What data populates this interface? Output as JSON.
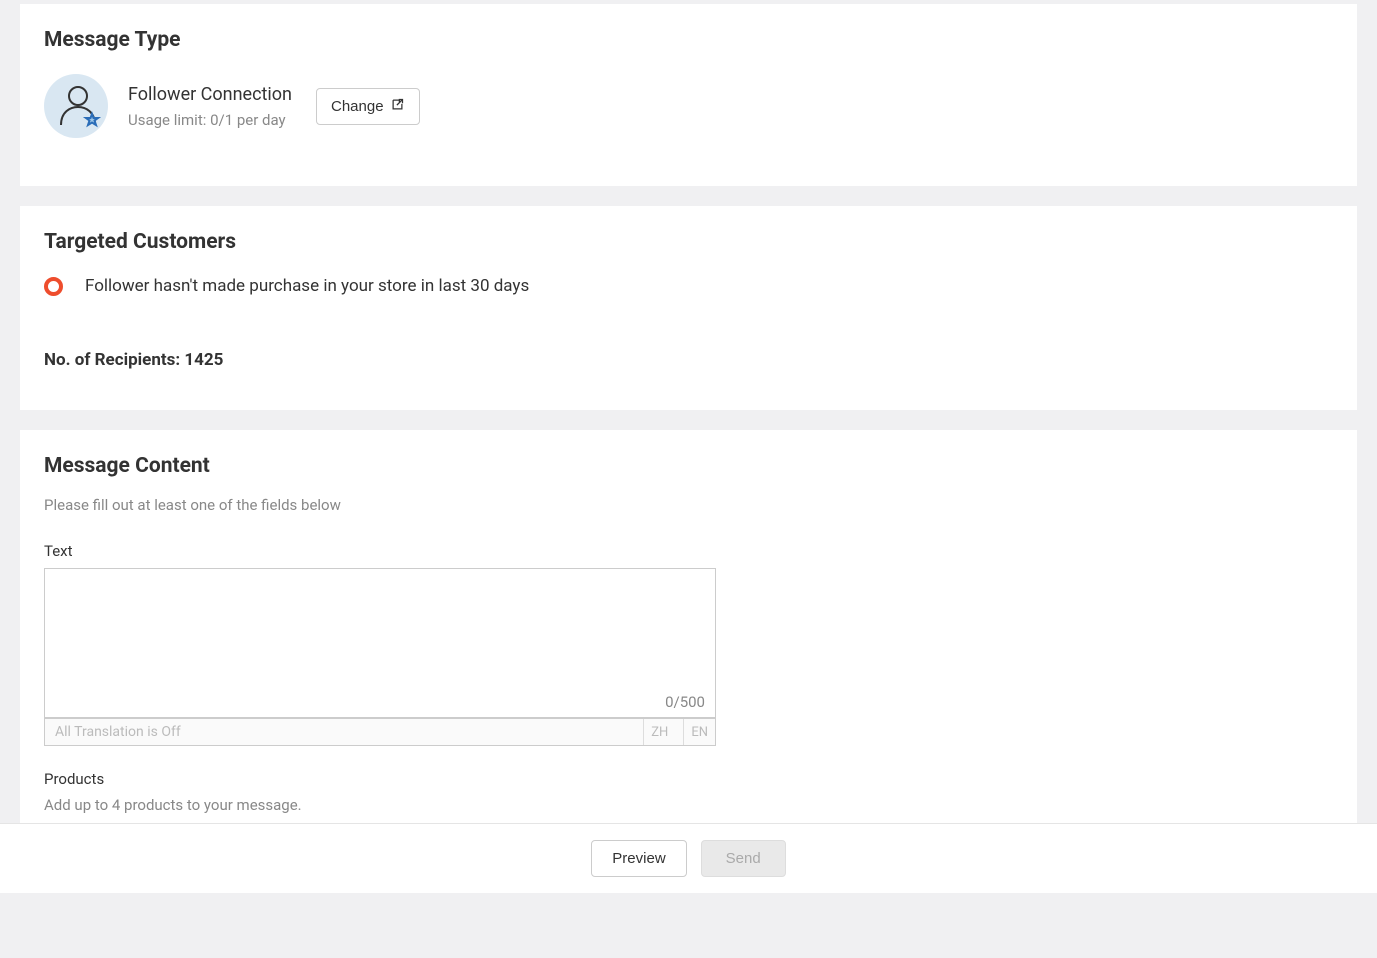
{
  "messageType": {
    "title": "Message Type",
    "name": "Follower Connection",
    "usage": "Usage limit: 0/1 per day",
    "changeLabel": "Change"
  },
  "targeted": {
    "title": "Targeted Customers",
    "option": "Follower hasn't made purchase in your store in last 30 days",
    "recipientsLabel": "No. of Recipients: 1425"
  },
  "content": {
    "title": "Message Content",
    "sub": "Please fill out at least one of the fields below",
    "textLabel": "Text",
    "textValue": "",
    "counter": "0/500",
    "translation": "All Translation is Off",
    "langZh": "ZH",
    "langEn": "EN",
    "productsLabel": "Products",
    "productsHint": "Add up to 4 products to your message."
  },
  "footer": {
    "preview": "Preview",
    "send": "Send"
  }
}
